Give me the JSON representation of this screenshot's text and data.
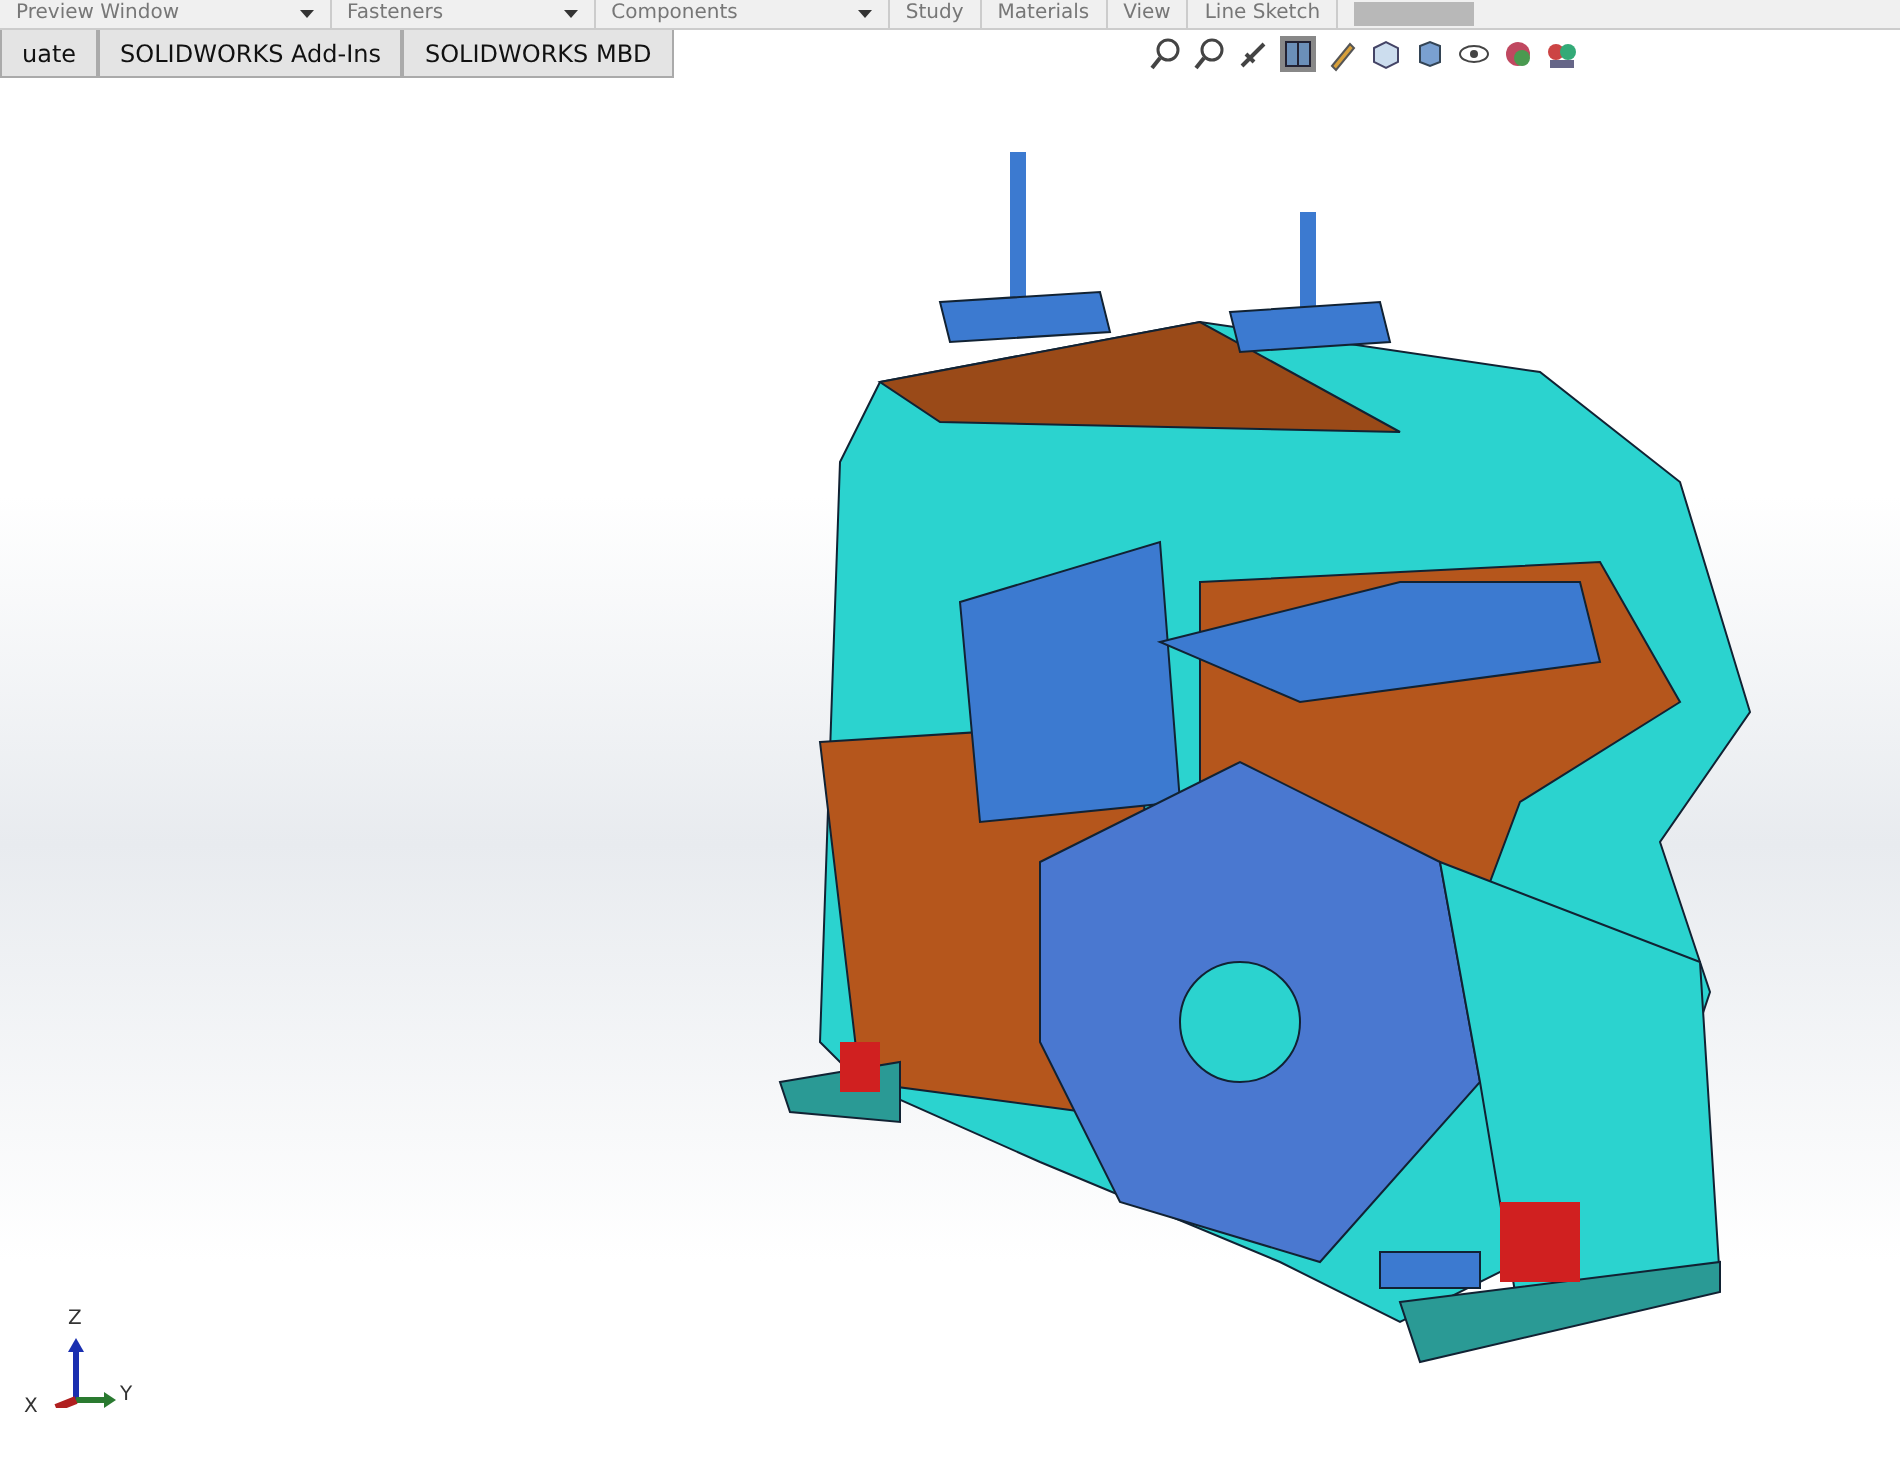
{
  "ribbon_labels": [
    {
      "label": "Preview Window",
      "dropdown": true
    },
    {
      "label": "Fasteners",
      "dropdown": true
    },
    {
      "label": "Components",
      "dropdown": true
    },
    {
      "label": "Study",
      "dropdown": false
    },
    {
      "label": "Materials",
      "dropdown": false
    },
    {
      "label": "View",
      "dropdown": false
    },
    {
      "label": "Line Sketch",
      "dropdown": false
    }
  ],
  "tabs": [
    {
      "label": "uate",
      "selected": false
    },
    {
      "label": "SOLIDWORKS Add-Ins",
      "selected": false
    },
    {
      "label": "SOLIDWORKS MBD",
      "selected": false
    }
  ],
  "triad": {
    "z": "Z",
    "y": "Y",
    "x": "X"
  }
}
